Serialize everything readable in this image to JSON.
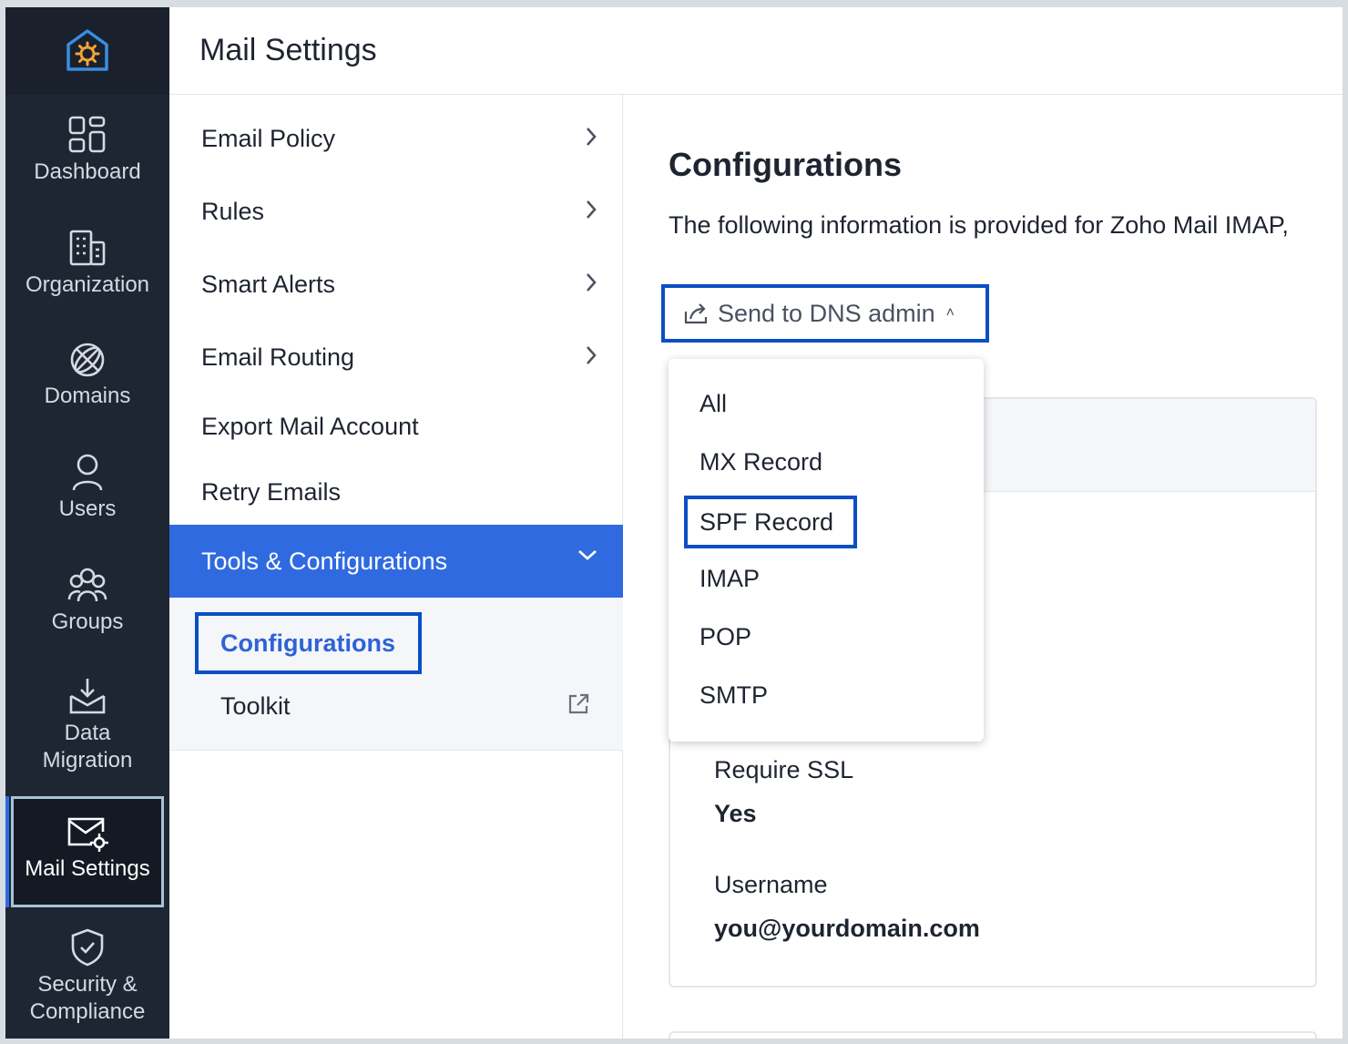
{
  "header": {
    "title": "Mail Settings"
  },
  "rail": {
    "items": [
      {
        "label": "Dashboard"
      },
      {
        "label": "Organization"
      },
      {
        "label": "Domains"
      },
      {
        "label": "Users"
      },
      {
        "label": "Groups"
      },
      {
        "label": "Data Migration"
      },
      {
        "label": "Mail Settings"
      },
      {
        "label": "Security & Compliance"
      }
    ]
  },
  "nav": {
    "items": [
      {
        "label": "Email Policy"
      },
      {
        "label": "Rules"
      },
      {
        "label": "Smart Alerts"
      },
      {
        "label": "Email Routing"
      },
      {
        "label": "Export Mail Account"
      },
      {
        "label": "Retry Emails"
      },
      {
        "label": "Tools & Configurations"
      }
    ],
    "sub": [
      {
        "label": "Configurations"
      },
      {
        "label": "Toolkit"
      }
    ]
  },
  "main": {
    "title": "Configurations",
    "description": "The following information is provided for Zoho Mail IMAP,",
    "dns_button": "Send to DNS admin",
    "dropdown": [
      "All",
      "MX Record",
      "SPF Record",
      "IMAP",
      "POP",
      "SMTP"
    ],
    "fields": [
      {
        "label": "Require SSL",
        "value": "Yes"
      },
      {
        "label": "Username",
        "value": "you@yourdomain.com"
      }
    ]
  },
  "colors": {
    "accent": "#2f6ae0",
    "highlight_border": "#0a4fc4",
    "rail_bg": "#1f2633"
  }
}
